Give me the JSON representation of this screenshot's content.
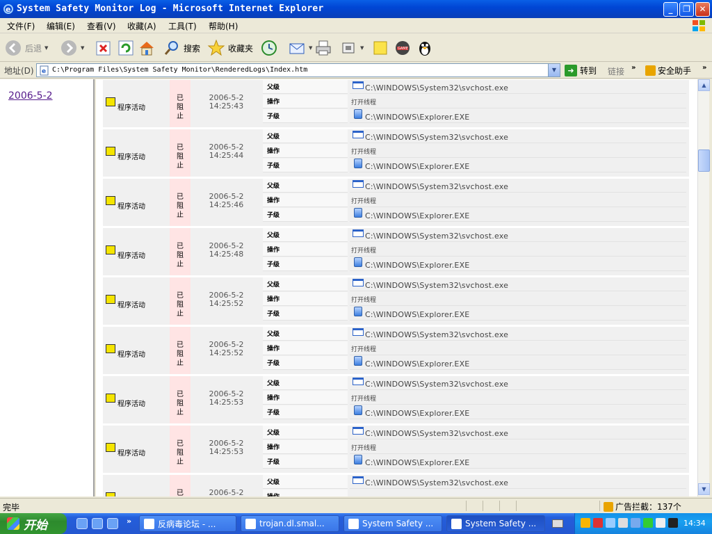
{
  "window": {
    "title": "System Safety Monitor Log - Microsoft Internet Explorer",
    "min_glyph": "_",
    "max_glyph": "❐",
    "close_glyph": "✕"
  },
  "menu": [
    "文件(F)",
    "编辑(E)",
    "查看(V)",
    "收藏(A)",
    "工具(T)",
    "帮助(H)"
  ],
  "toolbar": {
    "back_label": "后退",
    "search_label": "搜索",
    "favorites_label": "收藏夹"
  },
  "address": {
    "label": "地址(D)",
    "url": "C:\\Program Files\\System Safety Monitor\\RenderedLogs\\Index.htm",
    "go_label": "转到",
    "links_label": "链接",
    "more_glyph": "»",
    "safety_label": "安全助手"
  },
  "left": {
    "date_link": "2006-5-2"
  },
  "log": {
    "labels": {
      "parent": "父级",
      "operation": "操作",
      "child": "子级"
    },
    "rows": [
      {
        "activity": "程序活动",
        "status": "已阻止",
        "date": "2006-5-2",
        "time": "14:25:43",
        "parent": "C:\\WINDOWS\\System32\\svchost.exe",
        "operation": "打开线程",
        "child": "C:\\WINDOWS\\Explorer.EXE"
      },
      {
        "activity": "程序活动",
        "status": "已阻止",
        "date": "2006-5-2",
        "time": "14:25:44",
        "parent": "C:\\WINDOWS\\System32\\svchost.exe",
        "operation": "打开线程",
        "child": "C:\\WINDOWS\\Explorer.EXE"
      },
      {
        "activity": "程序活动",
        "status": "已阻止",
        "date": "2006-5-2",
        "time": "14:25:46",
        "parent": "C:\\WINDOWS\\System32\\svchost.exe",
        "operation": "打开线程",
        "child": "C:\\WINDOWS\\Explorer.EXE"
      },
      {
        "activity": "程序活动",
        "status": "已阻止",
        "date": "2006-5-2",
        "time": "14:25:48",
        "parent": "C:\\WINDOWS\\System32\\svchost.exe",
        "operation": "打开线程",
        "child": "C:\\WINDOWS\\Explorer.EXE"
      },
      {
        "activity": "程序活动",
        "status": "已阻止",
        "date": "2006-5-2",
        "time": "14:25:52",
        "parent": "C:\\WINDOWS\\System32\\svchost.exe",
        "operation": "打开线程",
        "child": "C:\\WINDOWS\\Explorer.EXE"
      },
      {
        "activity": "程序活动",
        "status": "已阻止",
        "date": "2006-5-2",
        "time": "14:25:52",
        "parent": "C:\\WINDOWS\\System32\\svchost.exe",
        "operation": "打开线程",
        "child": "C:\\WINDOWS\\Explorer.EXE"
      },
      {
        "activity": "程序活动",
        "status": "已阻止",
        "date": "2006-5-2",
        "time": "14:25:53",
        "parent": "C:\\WINDOWS\\System32\\svchost.exe",
        "operation": "打开线程",
        "child": "C:\\WINDOWS\\Explorer.EXE"
      },
      {
        "activity": "程序活动",
        "status": "已阻止",
        "date": "2006-5-2",
        "time": "14:25:53",
        "parent": "C:\\WINDOWS\\System32\\svchost.exe",
        "operation": "打开线程",
        "child": "C:\\WINDOWS\\Explorer.EXE"
      },
      {
        "activity": "程序活动",
        "status": "已阻止",
        "date": "2006-5-2",
        "time": "",
        "parent": "C:\\WINDOWS\\System32\\svchost.exe",
        "operation": "",
        "child": ""
      }
    ]
  },
  "status": {
    "text": "完毕",
    "ad_block": "广告拦截：137个"
  },
  "taskbar": {
    "start_label": "开始",
    "quicklaunch_more": "»",
    "tasks": [
      {
        "label": "反病毒论坛 - ..."
      },
      {
        "label": "trojan.dl.smal..."
      },
      {
        "label": "System Safety ..."
      },
      {
        "label": "System Safety ..."
      }
    ],
    "clock": "14:34"
  }
}
